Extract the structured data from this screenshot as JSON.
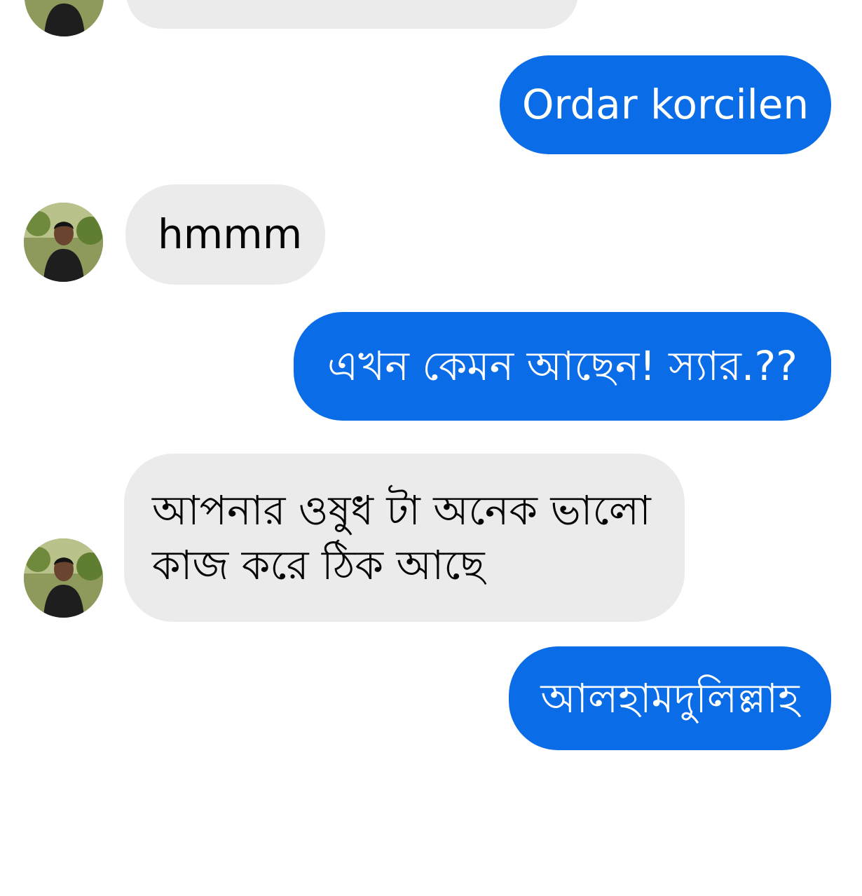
{
  "colors": {
    "outgoing_bubble": "#0a6ce6",
    "incoming_bubble": "#ebebeb",
    "outgoing_text": "#ffffff",
    "incoming_text": "#050505",
    "background": "#ffffff"
  },
  "messages": [
    {
      "direction": "incoming",
      "text": "",
      "avatar": "contact-avatar"
    },
    {
      "direction": "outgoing",
      "text": "Ordar korcilen"
    },
    {
      "direction": "incoming",
      "text": "hmmm",
      "avatar": "contact-avatar"
    },
    {
      "direction": "outgoing",
      "text": "এখন কেমন আছেন! স্যার.??"
    },
    {
      "direction": "incoming",
      "lines": [
        "আপনার ওষুধ টা অনেক ভালো",
        "কাজ করে ঠিক আছে"
      ],
      "avatar": "contact-avatar"
    },
    {
      "direction": "outgoing",
      "text": "আলহামদুলিল্লাহ"
    }
  ]
}
